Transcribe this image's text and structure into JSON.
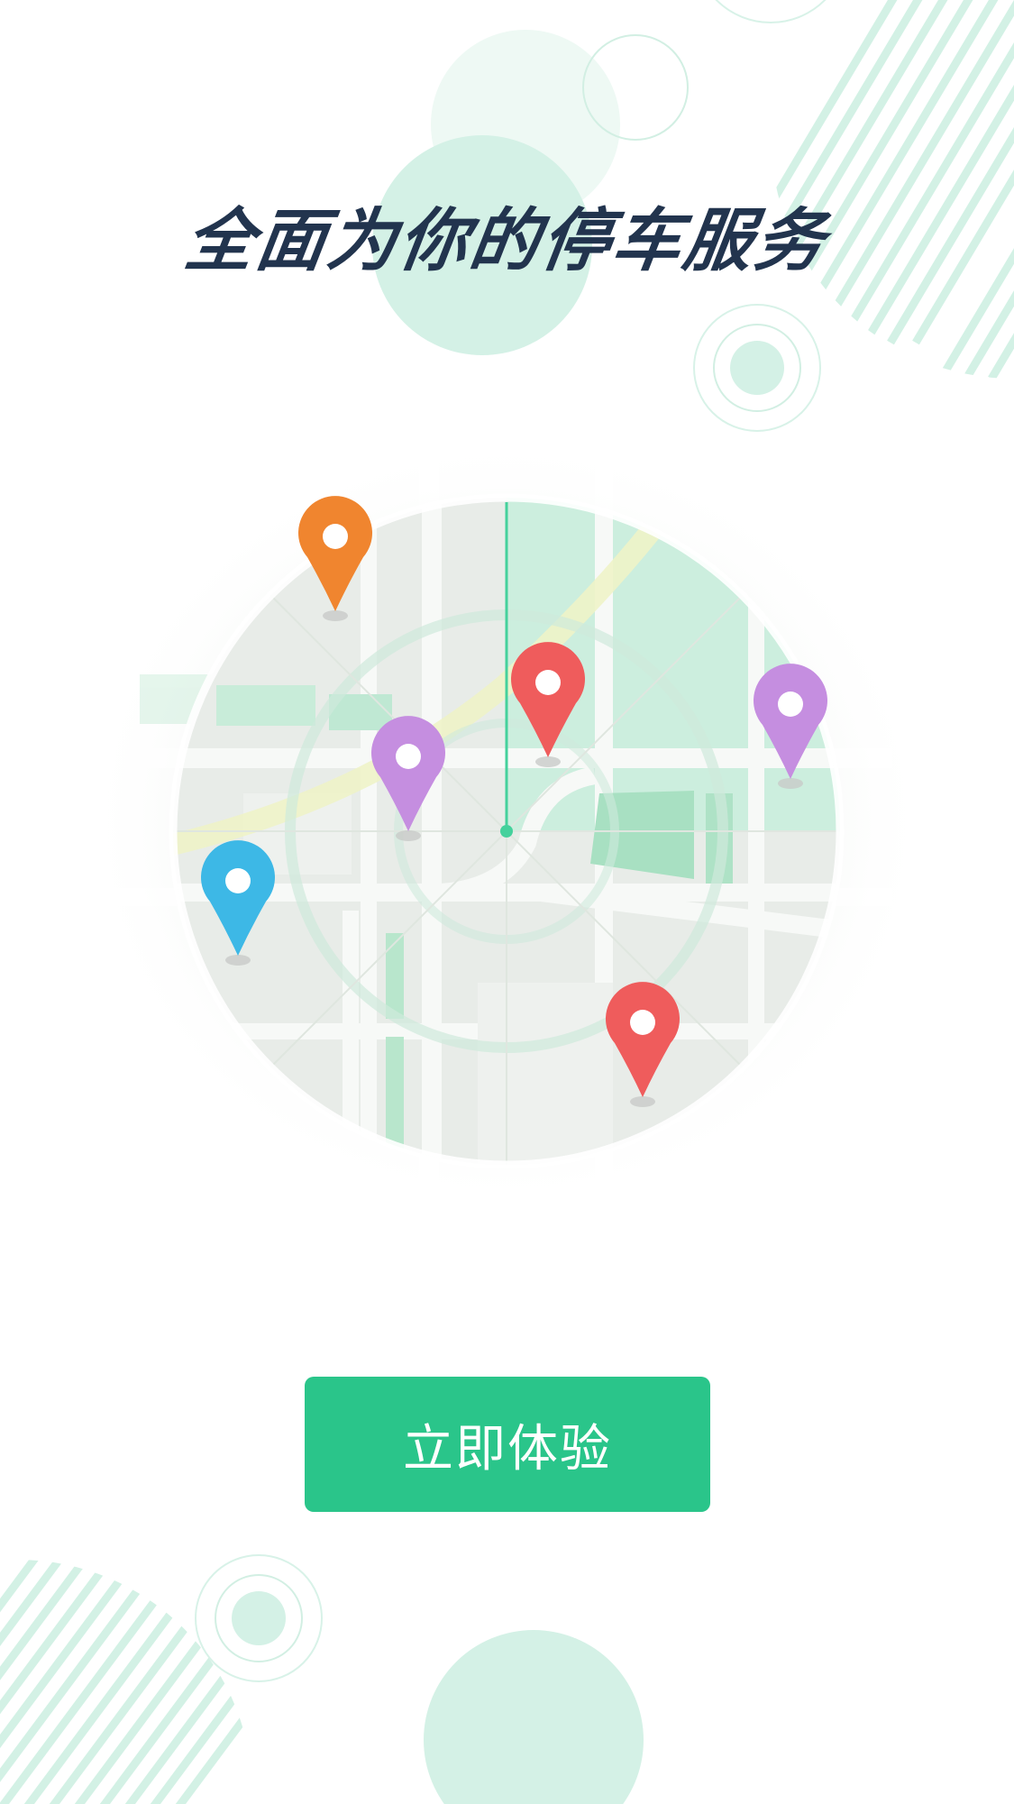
{
  "headline": "全面为你的停车服务",
  "cta_button": {
    "label": "立即体验"
  },
  "colors": {
    "accent_green": "#2ac58a",
    "mint_light": "#d4f1e6",
    "headline_navy": "#22344e",
    "pin_orange": "#f0852f",
    "pin_red": "#ef5c5c",
    "pin_purple": "#c58ee0",
    "pin_blue": "#3db8e6"
  },
  "map_pins": [
    {
      "name": "orange-pin",
      "color": "#f0852f"
    },
    {
      "name": "red-pin-top",
      "color": "#ef5c5c"
    },
    {
      "name": "purple-pin-right",
      "color": "#c58ee0"
    },
    {
      "name": "purple-pin-center",
      "color": "#c58ee0"
    },
    {
      "name": "blue-pin",
      "color": "#3db8e6"
    },
    {
      "name": "red-pin-bottom",
      "color": "#ef5c5c"
    }
  ]
}
